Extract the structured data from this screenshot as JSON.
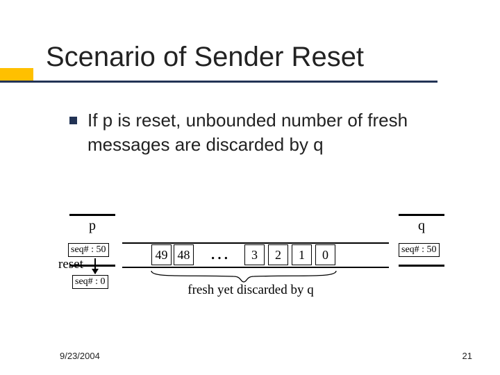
{
  "title": "Scenario of Sender Reset",
  "bullet": "If p is reset, unbounded number of fresh messages are discarded by q",
  "proc_p": {
    "label": "p"
  },
  "proc_q": {
    "label": "q"
  },
  "seq_p_before": "seq# : 50",
  "seq_p_after": "seq# : 0",
  "seq_q": "seq# : 50",
  "reset_label": "reset",
  "messages": {
    "m0": "49",
    "m1": "48",
    "m2": "3",
    "m3": "2",
    "m4": "1",
    "m5": "0"
  },
  "ellipsis": "…",
  "caption": "fresh yet discarded by q",
  "footer": {
    "date": "9/23/2004",
    "page": "21"
  }
}
